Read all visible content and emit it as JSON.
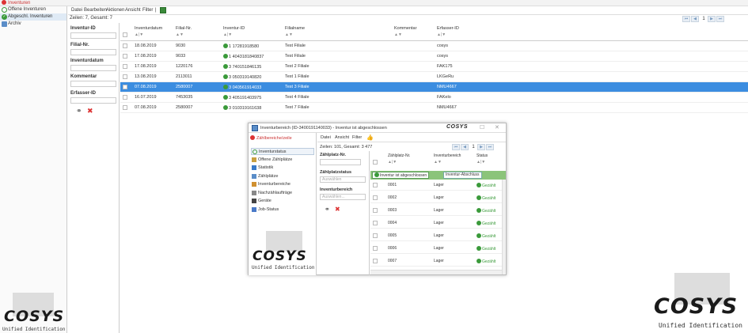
{
  "topbar": {
    "home_label": "Inventuren"
  },
  "sidebar": {
    "items": [
      {
        "label": "Offene Inventuren",
        "icon": "circle-icon"
      },
      {
        "label": "Abgeschl. Inventuren",
        "icon": "check-icon"
      },
      {
        "label": "Archiv",
        "icon": "archive-icon"
      }
    ],
    "logo_text": "COSYS",
    "logo_tagline": "Unified Identification"
  },
  "menubar": {
    "items": [
      "Datei",
      "Bearbeiten",
      "Aktionen",
      "Ansicht",
      "Filter",
      "|"
    ]
  },
  "status": {
    "row_count": "Zeilen: 7, Gesamt: 7",
    "page": "1"
  },
  "filters": {
    "fields": [
      {
        "label": "Inventur-ID",
        "value": ""
      },
      {
        "label": "Filial-Nr.",
        "value": ""
      },
      {
        "label": "Inventurdatum",
        "value": ""
      },
      {
        "label": "Kommentar",
        "value": ""
      },
      {
        "label": "Erfasser-ID",
        "value": ""
      }
    ]
  },
  "grid": {
    "columns": [
      "Inventurdatum",
      "Filial-Nr.",
      "Inventur-ID",
      "Filialname",
      "Kommentar",
      "Erfasser-ID"
    ],
    "rows": [
      {
        "date": "18.08.2019",
        "filial": "9030",
        "id": "1 17281918580",
        "name": "Test Filiale",
        "comment": "",
        "user": "cosys",
        "selected": false
      },
      {
        "date": "17.08.2019",
        "filial": "9033",
        "id": "1 4043181840837",
        "name": "Test Filiale",
        "comment": "",
        "user": "cosys",
        "selected": false
      },
      {
        "date": "17.08.2019",
        "filial": "1220176",
        "id": "3 740151846135",
        "name": "Test 2 Filiale",
        "comment": "",
        "user": "FAK175",
        "selected": false
      },
      {
        "date": "13.08.2019",
        "filial": "2113011",
        "id": "3 050319140820",
        "name": "Test 1 Filiale",
        "comment": "",
        "user": "LKGeRu",
        "selected": false
      },
      {
        "date": "07.08.2019",
        "filial": "2580007",
        "id": "3 040561914033",
        "name": "Test 3 Filiale",
        "comment": "",
        "user": "NMU4667",
        "selected": true
      },
      {
        "date": "16.07.2019",
        "filial": "7453035",
        "id": "3 405191403975",
        "name": "Test 4 Filiale",
        "comment": "",
        "user": "FAKelo",
        "selected": false
      },
      {
        "date": "07.08.2019",
        "filial": "2580007",
        "id": "3 010319161638",
        "name": "Test 7 Filiale",
        "comment": "",
        "user": "NMU4667",
        "selected": false
      }
    ]
  },
  "popup": {
    "title": "Inventurbereich (ID-3400191140033) - Inventur ist abgeschlossen",
    "title_logo": "COSYS",
    "back_label": "Zählbereiche/zeile",
    "nav": [
      {
        "label": "Inventurstatus",
        "icon": "circle-icon"
      },
      {
        "label": "Offene Zählplätze",
        "icon": "pencil-icon"
      },
      {
        "label": "Statistik",
        "icon": "chart-icon"
      },
      {
        "label": "Zählplätze",
        "icon": "list-icon"
      },
      {
        "label": "Inventurbereiche",
        "icon": "box-icon"
      },
      {
        "label": "Nachzählaufträge",
        "icon": "tools-icon"
      },
      {
        "label": "Geräte",
        "icon": "device-icon"
      },
      {
        "label": "Job-Status",
        "icon": "user-icon"
      }
    ],
    "menu": [
      "Datei",
      "Ansicht",
      "Filter"
    ],
    "row_count": "Zeilen: 101, Gesamt: 3 477",
    "page": "1",
    "filters": [
      {
        "label": "Zählplatz-Nr.",
        "value": ""
      },
      {
        "label": "Zählplatzstatus",
        "value": "Auswählen"
      },
      {
        "label": "Inventurbereich",
        "value": "Auswählen..."
      }
    ],
    "columns": [
      "Zählplatz-Nr.",
      "Inventurbereich",
      "Status"
    ],
    "status_bar": {
      "left": "Inventur ist abgeschlossen",
      "right": "Inventur-Abschluss"
    },
    "rows": [
      {
        "nr": "0001",
        "area": "Lager",
        "status": "Gezählt"
      },
      {
        "nr": "0002",
        "area": "Lager",
        "status": "Gezählt"
      },
      {
        "nr": "0003",
        "area": "Lager",
        "status": "Gezählt"
      },
      {
        "nr": "0004",
        "area": "Lager",
        "status": "Gezählt"
      },
      {
        "nr": "0005",
        "area": "Lager",
        "status": "Gezählt"
      },
      {
        "nr": "0006",
        "area": "Lager",
        "status": "Gezählt"
      },
      {
        "nr": "0007",
        "area": "Lager",
        "status": "Gezählt"
      }
    ],
    "logo_text": "COSYS",
    "logo_tagline": "Unified Identification"
  },
  "colors": {
    "accent": "#3c8de0",
    "success": "#3a9a3a",
    "danger": "#d33333"
  }
}
